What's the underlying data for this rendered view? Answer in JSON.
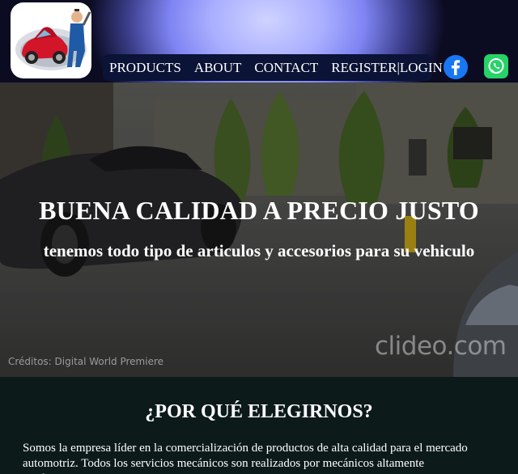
{
  "nav": {
    "products": "PRODUCTS",
    "about": "ABOUT",
    "contact": "CONTACT",
    "register_login": "REGISTER|LOGIN"
  },
  "social": {
    "facebook_icon": "facebook-icon",
    "whatsapp_icon": "whatsapp-icon"
  },
  "hero": {
    "title": "BUENA CALIDAD A PRECIO JUSTO",
    "subtitle": "tenemos todo tipo de articulos y accesorios para su vehiculo",
    "credits": "Créditos: Digital World Premiere",
    "watermark": "clideo.com"
  },
  "why": {
    "title": "¿POR QUÉ ELEGIRNOS?",
    "text": "Somos la empresa líder en la comercialización de productos de alta calidad para el mercado automotriz. Todos los servicios mecánicos son realizados por mecánicos altamente calificados."
  },
  "colors": {
    "nav_bg": "#0b1336",
    "facebook": "#1877f2",
    "whatsapp": "#25d366",
    "section_bg": "#0d1a1a"
  }
}
